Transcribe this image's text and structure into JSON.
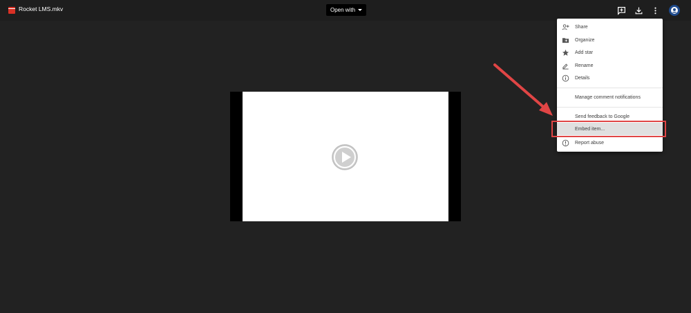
{
  "header": {
    "file_title": "Rocket LMS.mkv",
    "open_with_label": "Open with",
    "icons": [
      "add-comment-icon",
      "download-icon",
      "more-vert-icon",
      "account-avatar"
    ]
  },
  "menu": {
    "items": [
      {
        "label": "Share",
        "icon": "add-person-icon"
      },
      {
        "label": "Organize",
        "icon": "folder-move-icon"
      },
      {
        "label": "Add star",
        "icon": "star-icon"
      },
      {
        "label": "Rename",
        "icon": "pencil-icon"
      },
      {
        "label": "Details",
        "icon": "info-icon"
      },
      {
        "label": "Manage comment notifications",
        "icon": ""
      },
      {
        "label": "Send feedback to Google",
        "icon": ""
      },
      {
        "label": "Embed item...",
        "icon": ""
      },
      {
        "label": "Report abuse",
        "icon": "report-icon"
      }
    ]
  },
  "colors": {
    "background": "#222222",
    "topbar": "#1e1e1e",
    "file_icon": "#d93025",
    "annotation": "#e04545",
    "avatar": "#1e4a8c"
  }
}
